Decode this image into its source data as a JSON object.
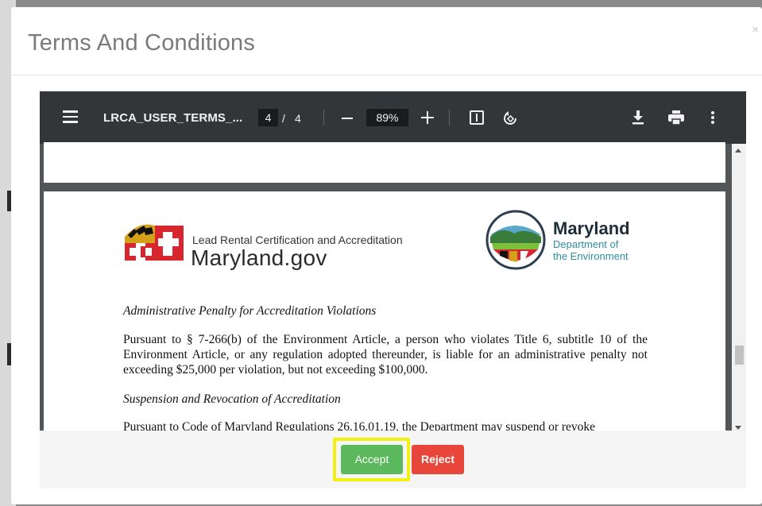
{
  "modal": {
    "title": "Terms And Conditions",
    "close_glyph": "×"
  },
  "pdf_viewer": {
    "filename": "LRCA_USER_TERMS_...",
    "current_page": "4",
    "page_separator": "/",
    "total_pages": "4",
    "zoom": "89%",
    "icons": [
      "menu-icon",
      "zoom-out-icon",
      "zoom-in-icon",
      "fit-page-icon",
      "rotate-icon",
      "download-icon",
      "print-icon",
      "more-options-icon"
    ]
  },
  "document": {
    "logo_left": {
      "subtitle": "Lead Rental Certification and Accreditation",
      "title": "Maryland.gov"
    },
    "logo_right": {
      "title": "Maryland",
      "subtitle_line1": "Department of",
      "subtitle_line2": "the Environment"
    },
    "section1_heading": "Administrative Penalty for Accreditation Violations",
    "section1_text": "Pursuant to § 7-266(b) of the Environment Article, a person who violates Title 6, subtitle 10 of the Environment Article, or any regulation adopted thereunder, is liable for an administrative penalty not exceeding $25,000 per violation, but not exceeding $100,000.",
    "section2_heading": "Suspension and Revocation of Accreditation",
    "section2_text_partial": "Pursuant to Code of Maryland Regulations 26.16.01.19, the Department may suspend or revoke"
  },
  "footer": {
    "accept_label": "Accept",
    "reject_label": "Reject",
    "accept_color": "#5cb85c",
    "reject_color": "#e8463a",
    "highlight_color": "#f2f010"
  }
}
